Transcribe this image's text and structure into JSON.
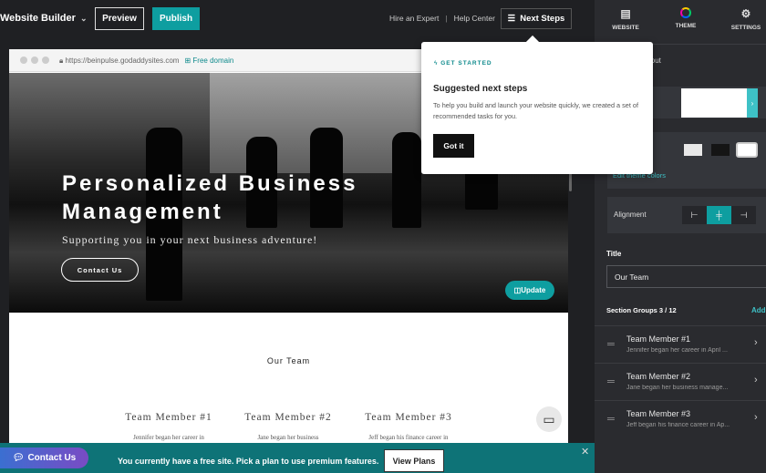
{
  "topbar": {
    "brand": "Website Builder",
    "preview": "Preview",
    "publish": "Publish",
    "hire_expert": "Hire an Expert",
    "separator": "|",
    "help_center": "Help Center",
    "next_steps": "Next Steps"
  },
  "browser": {
    "url": "https://beinpulse.godaddysites.com",
    "free_domain": "Free domain"
  },
  "hero": {
    "title_line1": "Personalized Business",
    "title_line2": "Management",
    "subtitle": "Supporting you in your next business adventure!",
    "button": "Contact Us",
    "update": "Update"
  },
  "team": {
    "heading": "Our Team",
    "members": [
      {
        "name": "Team Member #1",
        "desc": "Jennifer began her career in"
      },
      {
        "name": "Team Member #2",
        "desc": "Jane began her business"
      },
      {
        "name": "Team Member #3",
        "desc": "Jeff began his finance career in"
      }
    ]
  },
  "banner": {
    "contact": "Contact Us",
    "message": "You currently have a free site. Pick a plan to use premium features.",
    "view_plans": "View Plans",
    "close": "✕"
  },
  "panel": {
    "tabs": [
      {
        "label": "WEBSITE",
        "icon": "browser-window-icon"
      },
      {
        "label": "THEME",
        "icon": "color-wheel-icon"
      },
      {
        "label": "SETTINGS",
        "icon": "gear-icon"
      }
    ],
    "section_name": "About",
    "edit_colors": "Edit theme colors",
    "alignment_label": "Alignment",
    "alignment_selected": "center",
    "title_label": "Title",
    "title_value": "Our Team",
    "section_groups": "Section Groups 3 / 12",
    "add": "Add",
    "items": [
      {
        "title": "Team Member #1",
        "summary": "Jennifer began her career in April ..."
      },
      {
        "title": "Team Member #2",
        "summary": "Jane began her business manage..."
      },
      {
        "title": "Team Member #3",
        "summary": "Jeff began his finance career in Ap..."
      }
    ]
  },
  "popover": {
    "eyebrow": "GET STARTED",
    "title": "Suggested next steps",
    "body": "To help you build and launch your website quickly, we created a set of recommended tasks for you.",
    "button": "Got it"
  },
  "colors": {
    "accent": "#0e9ea0",
    "banner": "#0e7377",
    "link": "#3ec1c6"
  }
}
